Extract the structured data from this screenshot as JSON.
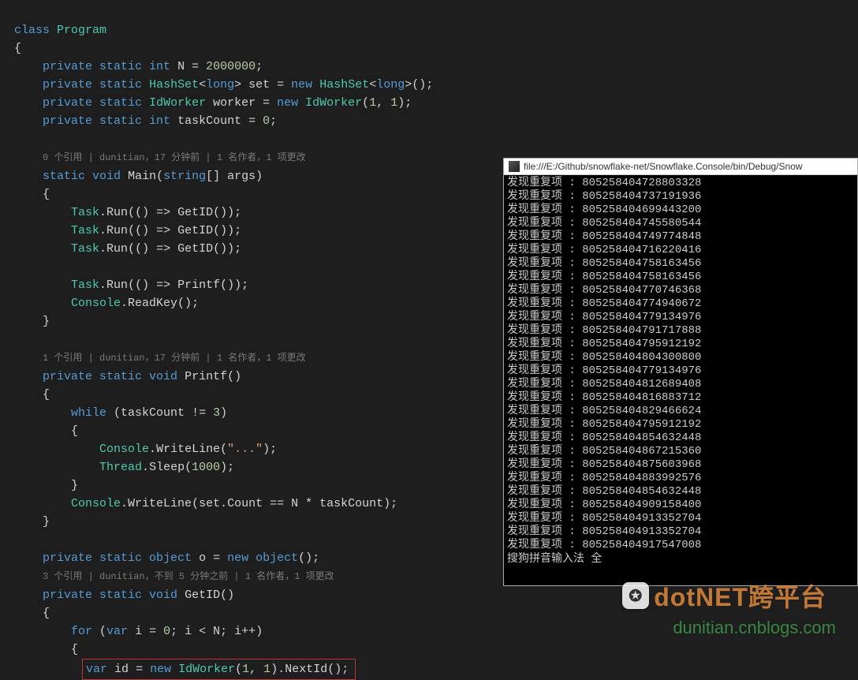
{
  "code": {
    "l1": {
      "class": "class",
      "program": "Program"
    },
    "l3": {
      "kw": "private static int",
      "name": "N",
      "val": "2000000"
    },
    "l4": {
      "kw": "private static",
      "type": "HashSet",
      "gen": "long",
      "name": "set",
      "new": "new",
      "type2": "HashSet",
      "gen2": "long"
    },
    "l5": {
      "kw": "private static",
      "type": "IdWorker",
      "name": "worker",
      "new": "new",
      "type2": "IdWorker",
      "args": "1, 1"
    },
    "l6": {
      "kw": "private static int",
      "name": "taskCount",
      "val": "0"
    },
    "lens1": "0 个引用 | dunitian，17 分钟前 | 1 名作者，1 项更改",
    "l8": {
      "kw": "static void",
      "name": "Main",
      "param": "string",
      "args": "args"
    },
    "run": {
      "task": "Task",
      "run": "Run",
      "call": "GetID()"
    },
    "run4": {
      "task": "Task",
      "run": "Run",
      "call": "Printf()"
    },
    "key": {
      "console": "Console",
      "read": "ReadKey()"
    },
    "lens2": "1 个引用 | dunitian，17 分钟前 | 1 名作者，1 项更改",
    "pf": {
      "kw": "private static void",
      "name": "Printf()"
    },
    "while": {
      "kw": "while",
      "cond": "taskCount != 3"
    },
    "wr": {
      "console": "Console",
      "wl": "WriteLine",
      "arg": "\"...\""
    },
    "sleep": {
      "thread": "Thread",
      "sleep": "Sleep",
      "arg": "1000"
    },
    "wr2": {
      "console": "Console",
      "wl": "WriteLine",
      "expr": "set.Count == N * taskCount"
    },
    "lock": {
      "kw": "private static object",
      "name": "o",
      "new": "new object"
    },
    "lens3": "3 个引用 | dunitian，不到 5 分钟之前 | 1 名作者，1 项更改",
    "gid": {
      "kw": "private static void",
      "name": "GetID()"
    },
    "for": {
      "kw": "for",
      "var": "var",
      "i": "i",
      "z": "0",
      "cond": "i < N",
      "inc": "i++"
    },
    "hi": {
      "var": "var",
      "id": "id",
      "new": "new",
      "type": "IdWorker",
      "a1": "1",
      "a2": "1",
      "next": "NextId()"
    }
  },
  "console": {
    "title": "file:///E:/Github/snowflake-net/Snowflake.Console/bin/Debug/Snow",
    "prefix": "发现重复项 :",
    "ids": [
      "805258404728803328",
      "805258404737191936",
      "805258404699443200",
      "805258404745580544",
      "805258404749774848",
      "805258404716220416",
      "805258404758163456",
      "805258404758163456",
      "805258404770746368",
      "805258404774940672",
      "805258404779134976",
      "805258404791717888",
      "805258404795912192",
      "805258404804300800",
      "805258404779134976",
      "805258404812689408",
      "805258404816883712",
      "805258404829466624",
      "805258404795912192",
      "805258404854632448",
      "805258404867215360",
      "805258404875603968",
      "805258404883992576",
      "805258404854632448",
      "805258404909158400",
      "805258404913352704",
      "805258404913352704",
      "805258404917547008"
    ],
    "ime": "搜狗拼音输入法 全"
  },
  "watermark": {
    "line1": "dotNET跨平台",
    "line2": "dunitian.cnblogs.com"
  }
}
